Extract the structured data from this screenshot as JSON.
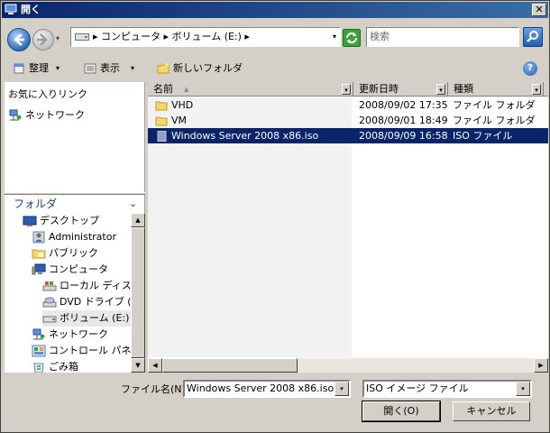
{
  "window": {
    "title": "開く",
    "close_glyph": "✕"
  },
  "address": {
    "breadcrumb": "▸ コンピュータ ▸ ボリューム (E:) ▸",
    "dropdown_glyph": "▾"
  },
  "search": {
    "placeholder": "検索"
  },
  "toolbar": {
    "organize_label": "整理",
    "view_label": "表示",
    "new_folder_label": "新しいフォルダ",
    "caret": "▾",
    "help_glyph": "?"
  },
  "favorites": {
    "items": [
      {
        "label": "お気に入りリンク"
      },
      {
        "label": "ネットワーク"
      }
    ]
  },
  "folders": {
    "header": "フォルダ",
    "chevron": "⌄",
    "tree": [
      {
        "label": "デスクトップ",
        "icon": "desktop-icon"
      },
      {
        "label": "Administrator",
        "icon": "user-icon"
      },
      {
        "label": "パブリック",
        "icon": "folder-icon"
      },
      {
        "label": "コンピュータ",
        "icon": "computer-icon"
      },
      {
        "label": "ローカル ディスク",
        "icon": "disk-icon"
      },
      {
        "label": "DVD ドライブ (D",
        "icon": "dvd-icon"
      },
      {
        "label": "ボリューム (E:)",
        "icon": "drive-icon",
        "selected": true
      },
      {
        "label": "ネットワーク",
        "icon": "network-icon"
      },
      {
        "label": "コントロール パネル",
        "icon": "control-panel-icon"
      },
      {
        "label": "ごみ箱",
        "icon": "recycle-bin-icon"
      }
    ]
  },
  "columns": {
    "name": "名前",
    "modified": "更新日時",
    "type": "種類",
    "sort_arrow": "▲",
    "drop": "▾"
  },
  "files": [
    {
      "name": "VHD",
      "modified": "2008/09/02 17:35",
      "type": "ファイル フォルダ",
      "icon": "folder-icon"
    },
    {
      "name": "VM",
      "modified": "2008/09/01 18:49",
      "type": "ファイル フォルダ",
      "icon": "folder-icon"
    },
    {
      "name": "Windows Server 2008 x86.iso",
      "modified": "2008/09/09 16:58",
      "type": "ISO ファイル",
      "icon": "iso-file-icon",
      "selected": true
    }
  ],
  "bottom": {
    "filename_label": "ファイル名(N):",
    "filename_value": "Windows Server 2008 x86.iso",
    "filter_value": "ISO イメージ ファイル",
    "open_label": "開く(O)",
    "cancel_label": "キャンセル"
  },
  "scroll": {
    "up": "▲",
    "down": "▼",
    "left": "◀",
    "right": "▶"
  },
  "colors": {
    "selection": "#0a246a",
    "titlebar": "#0a246a",
    "face": "#d4d0c8"
  }
}
